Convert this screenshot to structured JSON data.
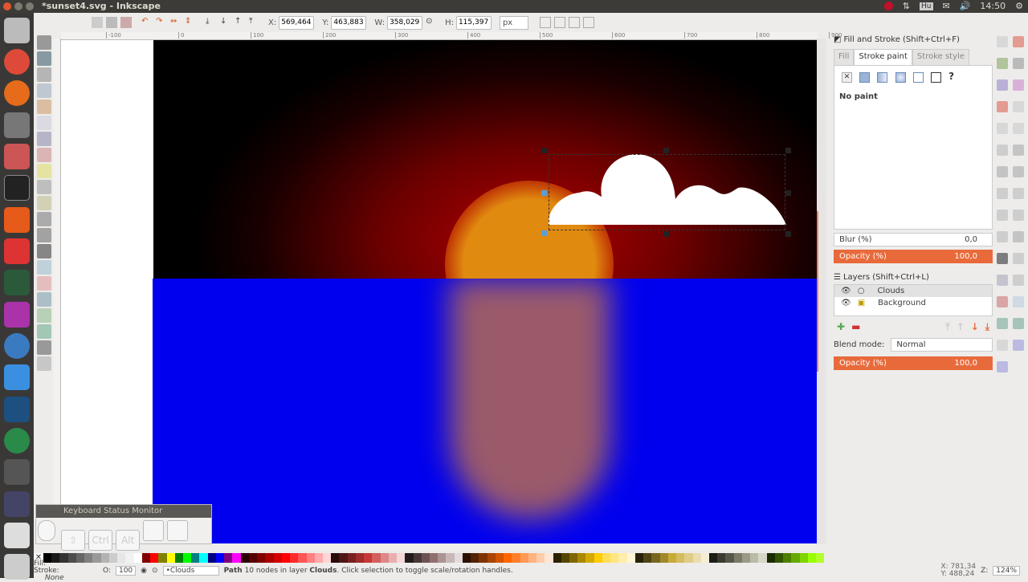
{
  "window": {
    "title": "*sunset4.svg - Inkscape"
  },
  "tray": {
    "time": "14:50",
    "keyboard": "Hu"
  },
  "toolbar": {
    "x_label": "X:",
    "x": "569,464",
    "y_label": "Y:",
    "y": "463,883",
    "w_label": "W:",
    "w": "358,029",
    "h_label": "H:",
    "h": "115,397",
    "unit": "px"
  },
  "ruler": {
    "ticks": [
      "-100",
      "0",
      "100",
      "200",
      "300",
      "400",
      "500",
      "600",
      "700",
      "800",
      "900"
    ]
  },
  "fill_stroke": {
    "title": "Fill and Stroke (Shift+Ctrl+F)",
    "tabs": [
      "Fill",
      "Stroke paint",
      "Stroke style"
    ],
    "active_tab": "Stroke paint",
    "paint_status": "No paint",
    "paint_unset": "?",
    "blur_label": "Blur (%)",
    "blur": "0,0",
    "opacity_label": "Opacity (%)",
    "opacity": "100,0"
  },
  "layers": {
    "title": "Layers (Shift+Ctrl+L)",
    "items": [
      {
        "name": "Clouds",
        "selected": true
      },
      {
        "name": "Background",
        "selected": false
      }
    ],
    "blend_label": "Blend mode:",
    "blend": "Normal",
    "opacity_label": "Opacity (%)",
    "opacity": "100,0"
  },
  "keyboard_monitor": {
    "title": "Keyboard Status Monitor",
    "keys": [
      "⇧",
      "Ctrl",
      "Alt",
      "",
      ""
    ]
  },
  "status": {
    "fill_label": "Fill:",
    "stroke_label": "Stroke:",
    "stroke": "None",
    "o_label": "O:",
    "opacity": "100",
    "layer": "•Clouds",
    "msg_bold": "Path",
    "msg": " 10 nodes in layer ",
    "msg_layer": "Clouds",
    "msg_end": ". Click selection to toggle scale/rotation handles.",
    "cursor_x": "X: 781,34",
    "cursor_y": "Y: 488,24",
    "zoom_label": "Z:",
    "zoom": "124%"
  },
  "colors": {
    "accent": "#e86a3b",
    "sea": "#0000ee",
    "selection": "#333333"
  },
  "palette": [
    "#000000",
    "#1a1a1a",
    "#333333",
    "#4d4d4d",
    "#666666",
    "#808080",
    "#999999",
    "#b3b3b3",
    "#cccccc",
    "#e6e6e6",
    "#f2f2f2",
    "#ffffff",
    "#800000",
    "#ff0000",
    "#808000",
    "#ffff00",
    "#008000",
    "#00ff00",
    "#008080",
    "#00ffff",
    "#000080",
    "#0000ff",
    "#800080",
    "#ff00ff",
    "#2b0000",
    "#550000",
    "#800000",
    "#aa0000",
    "#d40000",
    "#ff0000",
    "#ff2a2a",
    "#ff5555",
    "#ff8080",
    "#ffaaaa",
    "#ffd5d5",
    "#280b0b",
    "#501616",
    "#782121",
    "#a02c2c",
    "#c83737",
    "#d35f5f",
    "#de8787",
    "#e9afaf",
    "#f4d7d7",
    "#241c1c",
    "#483737",
    "#6c5353",
    "#916f6f",
    "#ac9393",
    "#c8b7b7",
    "#e3dbdb",
    "#2b1100",
    "#552200",
    "#803300",
    "#aa4400",
    "#d45500",
    "#ff6600",
    "#ff7f2a",
    "#ff9955",
    "#ffb380",
    "#ffccaa",
    "#ffe6d5",
    "#2b2200",
    "#554400",
    "#806600",
    "#aa8800",
    "#d4aa00",
    "#ffcc00",
    "#ffdd55",
    "#ffe680",
    "#ffeeaa",
    "#fff6d5",
    "#28220b",
    "#504416",
    "#786721",
    "#a0892c",
    "#c8ab37",
    "#d4bc5f",
    "#dfcd87",
    "#e9ddaf",
    "#f4eed7",
    "#1c1c17",
    "#3a3a2e",
    "#56564a",
    "#7a7a66",
    "#9a9a87",
    "#bbbba6",
    "#d7d7c9",
    "#1a2b00",
    "#335500",
    "#4d8000",
    "#66aa00",
    "#80d400",
    "#99ff00",
    "#b3ff2a"
  ]
}
